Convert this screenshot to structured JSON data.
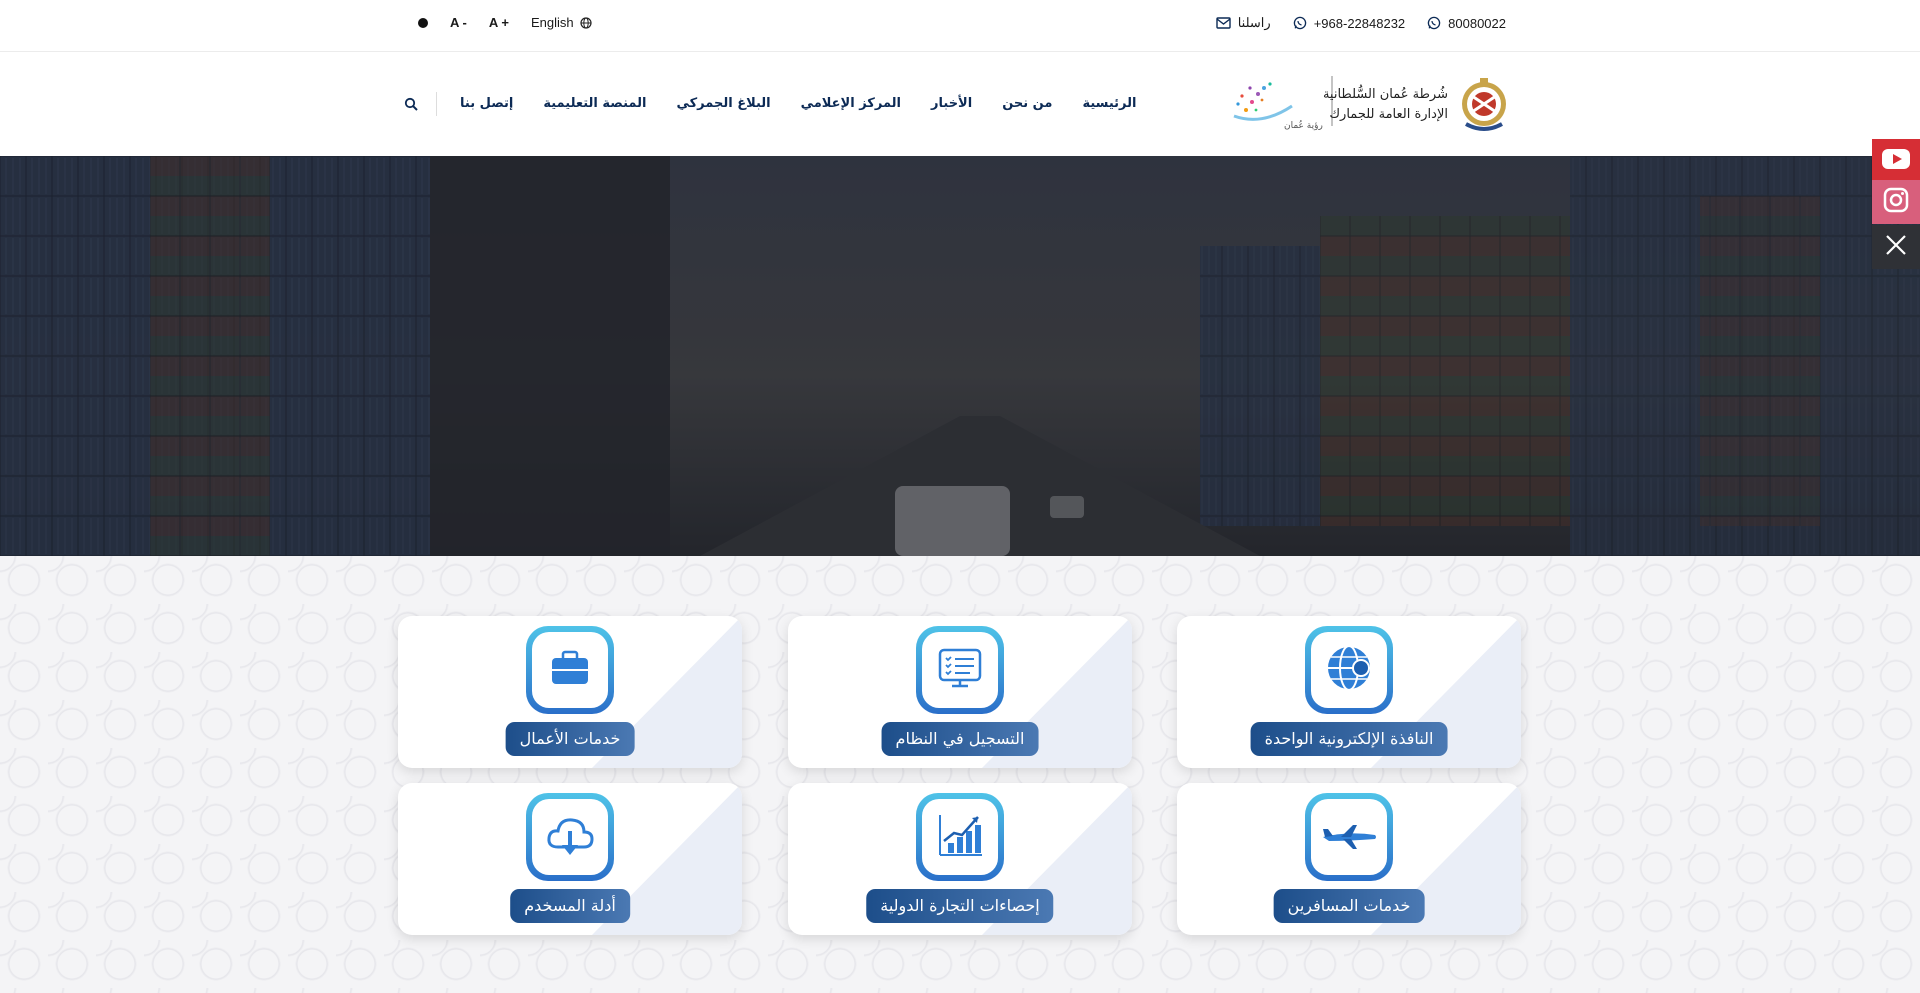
{
  "topbar": {
    "contrast_toggle": "●",
    "font_decrease": "A -",
    "font_increase": "A +",
    "language": "English",
    "contact_us": "راسلنا",
    "whatsapp_number": "+968-22848232",
    "hotline": "80080022"
  },
  "nav": {
    "items": [
      {
        "label": "الرئيسية"
      },
      {
        "label": "من نحن"
      },
      {
        "label": "الأخبار"
      },
      {
        "label": "المركز الإعلامي"
      },
      {
        "label": "البلاغ الجمركي"
      },
      {
        "label": "المنصة التعليمية"
      },
      {
        "label": "إتصل بنا"
      }
    ],
    "logo_text_line1": "شُرطة عُمان السُّلطانية",
    "logo_text_line2": "الإدارة العامة للجمارك",
    "logo_vision_text": "رؤية عُمان"
  },
  "cards": [
    {
      "label": "النافذة الإلكترونية الواحدة",
      "icon": "globe-icon"
    },
    {
      "label": "التسجيل في النظام",
      "icon": "registration-icon"
    },
    {
      "label": "خدمات الأعمال",
      "icon": "briefcase-icon"
    },
    {
      "label": "خدمات المسافرين",
      "icon": "airplane-icon"
    },
    {
      "label": "إحصاءات التجارة الدولية",
      "icon": "chart-icon"
    },
    {
      "label": "أدلة المسخدم",
      "icon": "cloud-download-icon"
    }
  ],
  "social": [
    {
      "name": "youtube-icon",
      "color": "#d62e35"
    },
    {
      "name": "instagram-icon",
      "color": "#d85f7c"
    },
    {
      "name": "x-icon",
      "color": "#2f3136"
    }
  ],
  "colors": {
    "nav_text": "#0c2a55",
    "card_label_start": "#1d4e8a",
    "card_label_end": "#4b79b3",
    "badge_start": "#4fc3e8",
    "badge_end": "#2a6fc9"
  }
}
